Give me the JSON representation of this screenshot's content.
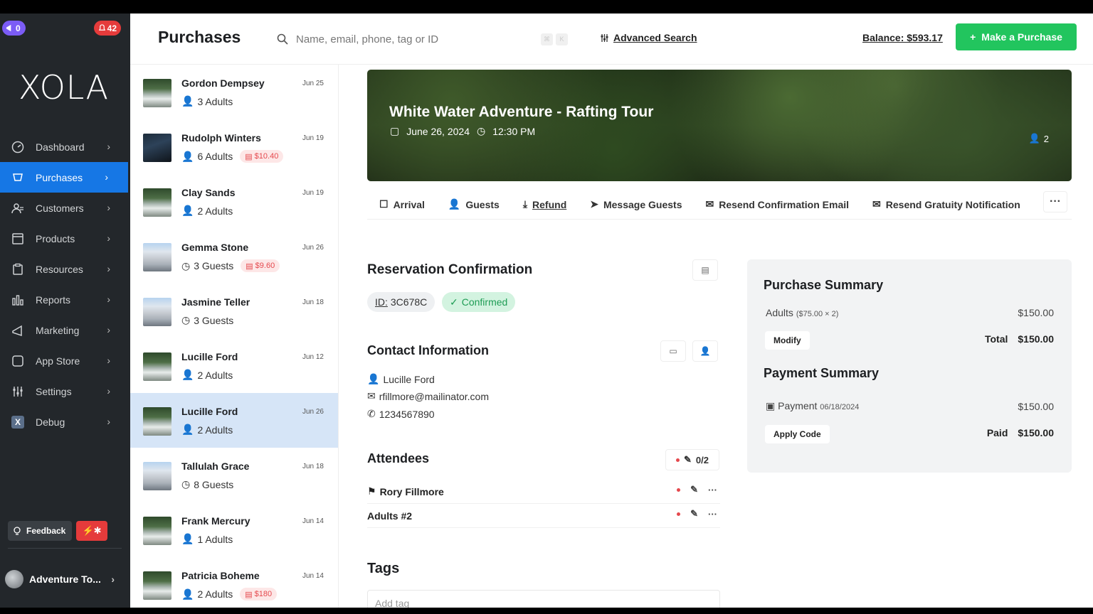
{
  "sidebar": {
    "notif_left": "0",
    "notif_right": "42",
    "logo": "XOLA",
    "items": [
      {
        "label": "Dashboard",
        "icon": "dashboard-icon"
      },
      {
        "label": "Purchases",
        "icon": "purchases-icon",
        "active": true
      },
      {
        "label": "Customers",
        "icon": "customers-icon"
      },
      {
        "label": "Products",
        "icon": "products-icon"
      },
      {
        "label": "Resources",
        "icon": "resources-icon"
      },
      {
        "label": "Reports",
        "icon": "reports-icon"
      },
      {
        "label": "Marketing",
        "icon": "marketing-icon"
      },
      {
        "label": "App Store",
        "icon": "app-store-icon"
      },
      {
        "label": "Settings",
        "icon": "settings-icon"
      },
      {
        "label": "Debug",
        "icon": "debug-icon"
      }
    ],
    "feedback": "Feedback",
    "account": "Adventure To..."
  },
  "header": {
    "title": "Purchases",
    "search_placeholder": "Name, email, phone, tag or ID",
    "advanced_search": "Advanced Search",
    "balance": "Balance: $593.17",
    "make_purchase": "Make a Purchase"
  },
  "purchases": [
    {
      "name": "Gordon Dempsey",
      "date": "Jun 25",
      "meta": "3 Adults",
      "owed": "",
      "thumb": "river"
    },
    {
      "name": "Rudolph Winters",
      "date": "Jun 19",
      "meta": "6 Adults",
      "owed": "$10.40",
      "thumb": "dark"
    },
    {
      "name": "Clay Sands",
      "date": "Jun 19",
      "meta": "2 Adults",
      "owed": "",
      "thumb": "river"
    },
    {
      "name": "Gemma Stone",
      "date": "Jun 26",
      "meta": "3 Guests",
      "owed": "$9.60",
      "thumb": "bldg"
    },
    {
      "name": "Jasmine Teller",
      "date": "Jun 18",
      "meta": "3 Guests",
      "owed": "",
      "thumb": "bldg"
    },
    {
      "name": "Lucille Ford",
      "date": "Jun 12",
      "meta": "2 Adults",
      "owed": "",
      "thumb": "river"
    },
    {
      "name": "Lucille Ford",
      "date": "Jun 26",
      "meta": "2 Adults",
      "owed": "",
      "thumb": "river",
      "selected": true
    },
    {
      "name": "Tallulah Grace",
      "date": "Jun 18",
      "meta": "8 Guests",
      "owed": "",
      "thumb": "bldg"
    },
    {
      "name": "Frank Mercury",
      "date": "Jun 14",
      "meta": "1 Adults",
      "owed": "",
      "thumb": "river"
    },
    {
      "name": "Patricia Boheme",
      "date": "Jun 14",
      "meta": "2 Adults",
      "owed": "$180",
      "thumb": "river"
    }
  ],
  "hero": {
    "title": "White Water Adventure - Rafting Tour",
    "date": "June 26, 2024",
    "time": "12:30 PM",
    "guests": "2"
  },
  "tabs": [
    "Arrival",
    "Guests",
    "Refund",
    "Message Guests",
    "Resend Confirmation Email",
    "Resend Gratuity Notification"
  ],
  "reservation": {
    "title": "Reservation Confirmation",
    "id_label": "ID:",
    "id_value": "3C678C",
    "status": "Confirmed"
  },
  "contact": {
    "title": "Contact Information",
    "name": "Lucille Ford",
    "email": "rfillmore@mailinator.com",
    "phone": "1234567890"
  },
  "attendees": {
    "title": "Attendees",
    "count": "0/2",
    "rows": [
      "Rory Fillmore",
      "Adults #2"
    ]
  },
  "tags": {
    "title": "Tags",
    "placeholder": "Add tag"
  },
  "purchase_summary": {
    "title": "Purchase Summary",
    "line_label": "Adults",
    "line_detail": "($75.00 × 2)",
    "line_amount": "$150.00",
    "modify": "Modify",
    "total_label": "Total",
    "total_value": "$150.00"
  },
  "payment_summary": {
    "title": "Payment Summary",
    "payment_label": "Payment",
    "payment_date": "06/18/2024",
    "payment_amount": "$150.00",
    "apply_code": "Apply Code",
    "paid_label": "Paid",
    "paid_value": "$150.00"
  }
}
